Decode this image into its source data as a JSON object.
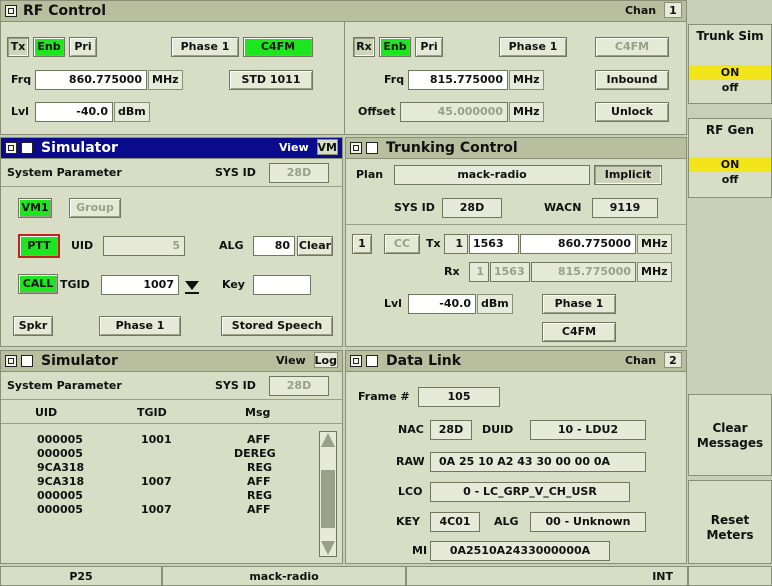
{
  "rf_control": {
    "title": "RF Control",
    "chan_label": "Chan",
    "chan_value": "1",
    "tx": {
      "label": "Tx",
      "enb": "Enb",
      "pri": "Pri",
      "phase": "Phase 1",
      "mod": "C4FM",
      "std": "STD 1011",
      "frq_label": "Frq",
      "frq": "860.775000",
      "frq_unit": "MHz",
      "lvl_label": "Lvl",
      "lvl": "-40.0",
      "lvl_unit": "dBm"
    },
    "rx": {
      "label": "Rx",
      "enb": "Enb",
      "pri": "Pri",
      "phase": "Phase 1",
      "mod": "C4FM",
      "inbound": "Inbound",
      "unlock": "Unlock",
      "frq_label": "Frq",
      "frq": "815.775000",
      "frq_unit": "MHz",
      "offset_label": "Offset",
      "offset": "45.000000",
      "offset_unit": "MHz"
    }
  },
  "side": {
    "trunk_sim": "Trunk Sim",
    "trunk_on": "ON",
    "trunk_off": "off",
    "rf_gen": "RF Gen",
    "rf_on": "ON",
    "rf_off": "off",
    "clear_messages_1": "Clear",
    "clear_messages_2": "Messages",
    "reset_meters_1": "Reset",
    "reset_meters_2": "Meters"
  },
  "sim1": {
    "title": "Simulator",
    "view_label": "View",
    "view_value": "VM",
    "sys_param": "System Parameter",
    "sys_id_label": "SYS ID",
    "sys_id": "28D",
    "vm1": "VM1",
    "group": "Group",
    "ptt": "PTT",
    "uid_label": "UID",
    "uid": "5",
    "alg_label": "ALG",
    "alg": "80",
    "clear": "Clear",
    "call": "CALL",
    "tgid_label": "TGID",
    "tgid": "1007",
    "key_label": "Key",
    "key": "",
    "spkr": "Spkr",
    "phase": "Phase 1",
    "stored_speech": "Stored Speech"
  },
  "trunking": {
    "title": "Trunking Control",
    "plan_label": "Plan",
    "plan": "mack-radio",
    "implicit": "Implicit",
    "sys_id_label": "SYS ID",
    "sys_id": "28D",
    "wacn_label": "WACN",
    "wacn": "9119",
    "ch_num": "1",
    "cc": "CC",
    "tx_label": "Tx",
    "tx_a": "1",
    "tx_b": "1563",
    "tx_frq": "860.775000",
    "tx_unit": "MHz",
    "rx_label": "Rx",
    "rx_a": "1",
    "rx_b": "1563",
    "rx_frq": "815.775000",
    "rx_unit": "MHz",
    "lvl_label": "Lvl",
    "lvl": "-40.0",
    "lvl_unit": "dBm",
    "phase": "Phase 1",
    "mod": "C4FM"
  },
  "sim2": {
    "title": "Simulator",
    "view_label": "View",
    "view_value": "Log",
    "sys_param": "System Parameter",
    "sys_id_label": "SYS ID",
    "sys_id": "28D",
    "col_uid": "UID",
    "col_tgid": "TGID",
    "col_msg": "Msg",
    "rows": [
      {
        "uid": "000005",
        "tgid": "1001",
        "msg": "AFF"
      },
      {
        "uid": "000005",
        "tgid": "",
        "msg": "DEREG"
      },
      {
        "uid": "9CA318",
        "tgid": "",
        "msg": "REG"
      },
      {
        "uid": "9CA318",
        "tgid": "1007",
        "msg": "AFF"
      },
      {
        "uid": "000005",
        "tgid": "",
        "msg": "REG"
      },
      {
        "uid": "000005",
        "tgid": "1007",
        "msg": "AFF"
      }
    ]
  },
  "datalink": {
    "title": "Data Link",
    "chan_label": "Chan",
    "chan_value": "2",
    "frame_label": "Frame #",
    "frame": "105",
    "nac_label": "NAC",
    "nac": "28D",
    "duid_label": "DUID",
    "duid": "10 - LDU2",
    "raw_label": "RAW",
    "raw": "0A 25 10 A2 43 30 00 00 0A",
    "lco_label": "LCO",
    "lco": "0 - LC_GRP_V_CH_USR",
    "key_label": "KEY",
    "key": "4C01",
    "alg_label": "ALG",
    "alg": "00 - Unknown",
    "mi_label": "MI",
    "mi": "0A2510A2433000000A"
  },
  "status_bar": {
    "mode": "P25",
    "plan": "mack-radio",
    "ref": "INT"
  }
}
